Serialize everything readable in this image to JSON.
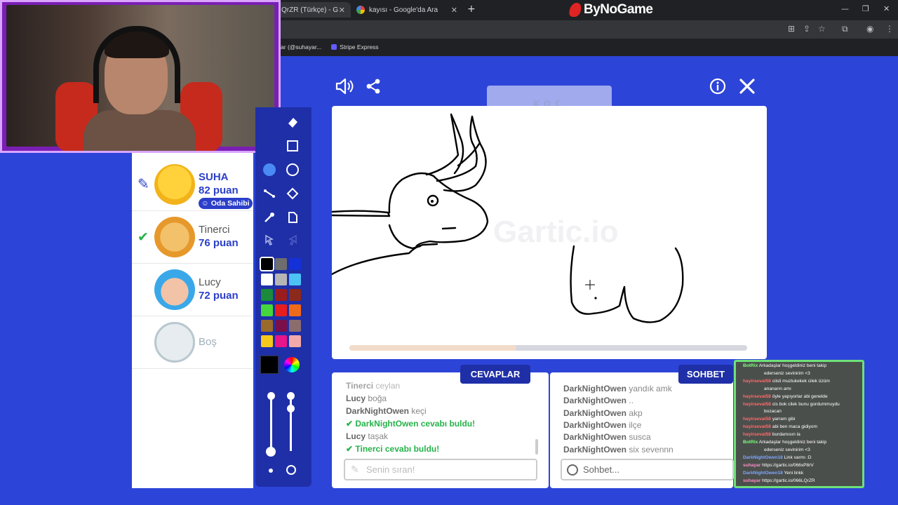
{
  "browser": {
    "tabs": [
      {
        "label": "QrZR (Türkçe) - G"
      },
      {
        "label": "kayısı - Google'da Ara"
      }
    ],
    "bookmarks": [
      "Yar (@suhayar...",
      "Stripe Express"
    ],
    "brand": "ByNoGame"
  },
  "game": {
    "hint_word": "KOÇ",
    "watermark": "Gartic.io",
    "progress": 0.42,
    "players": [
      {
        "name": "SUHA",
        "score": "82 puan",
        "badge": "Oda Sahibi",
        "status": "drawing"
      },
      {
        "name": "Tinerci",
        "score": "76 puan",
        "status": "guessed"
      },
      {
        "name": "Lucy",
        "score": "72 puan",
        "status": "none"
      },
      {
        "name": "Boş",
        "score": "",
        "status": "empty"
      }
    ],
    "palette": [
      "#000000",
      "#6e6e6e",
      "#1431d9",
      "#ffffff",
      "#b5b5b5",
      "#4cc2f5",
      "#1b8a3a",
      "#9b1c1c",
      "#8b2a1a",
      "#44d63c",
      "#e61e1e",
      "#f06a1a",
      "#9a6a2a",
      "#7a0f4a",
      "#8c6d6d",
      "#f5c81c",
      "#e8148a",
      "#f2a9a9"
    ],
    "current_color": "#000000"
  },
  "answers": {
    "tab": "CEVAPLAR",
    "placeholder": "Senin sıran!",
    "lines": [
      {
        "user": "Tinerci",
        "text": "ceylan"
      },
      {
        "user": "Lucy",
        "text": "boğa"
      },
      {
        "user": "DarkNightOwen",
        "text": "keçi"
      },
      {
        "user": "DarkNightOwen",
        "text": "cevabı buldu!",
        "ok": true
      },
      {
        "user": "Lucy",
        "text": "taşak"
      },
      {
        "user": "Tinerci",
        "text": "cevabı buldu!",
        "ok": true
      }
    ]
  },
  "chat": {
    "tab": "SOHBET",
    "placeholder": "Sohbet...",
    "lines": [
      {
        "user": "DarkNightOwen",
        "text": "yandık amk"
      },
      {
        "user": "DarkNightOwen",
        "text": ".."
      },
      {
        "user": "DarkNightOwen",
        "text": "akp"
      },
      {
        "user": "DarkNightOwen",
        "text": "ilçe"
      },
      {
        "user": "DarkNightOwen",
        "text": "susca"
      },
      {
        "user": "DarkNightOwen",
        "text": "six sevennn"
      }
    ]
  },
  "stream_chat": {
    "lines": [
      {
        "user": "BotRix",
        "text": "Arkadaşlar hoşgeldiniz beni takip"
      },
      {
        "user": "",
        "text": "ederseniz sevinirim <3"
      },
      {
        "user": "hayirsevat58",
        "text": "ciisli muzlukekek cilek üzüm"
      },
      {
        "user": "",
        "text": "ananarın amı"
      },
      {
        "user": "hayirsevat58",
        "text": "öyle yapıyorlar abi genelde"
      },
      {
        "user": "hayirsevat58",
        "text": "cis bok cilek bunu gordummuydu"
      },
      {
        "user": "",
        "text": "bozacan"
      },
      {
        "user": "hayirsevat58",
        "text": "yarram gibi"
      },
      {
        "user": "hayirsevat58",
        "text": "abi ben maca gidiyom"
      },
      {
        "user": "hayirsevat58",
        "text": "burdamısın la"
      },
      {
        "user": "BotRix",
        "text": "Arkadaşlar hoşgeldiniz beni takip"
      },
      {
        "user": "",
        "text": "ederseniz sevinirim <3"
      },
      {
        "user": "DarkNightOwen18",
        "text": "Link varmı :D"
      },
      {
        "user": "suhayar",
        "text": "https://gartic.io/066xP8rV"
      },
      {
        "user": "DarkNightOwen18",
        "text": "Yeni linkk"
      },
      {
        "user": "suhayar",
        "text": "https://gartic.io/066LQrZR"
      }
    ]
  }
}
